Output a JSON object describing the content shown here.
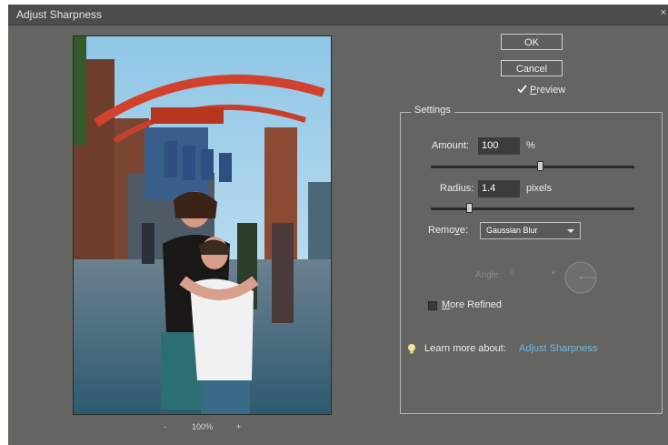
{
  "dialog": {
    "title": "Adjust Sharpness",
    "close_glyph": "×"
  },
  "buttons": {
    "ok": "OK",
    "cancel": "Cancel"
  },
  "preview_toggle": {
    "label": "Preview",
    "checked": true
  },
  "zoom": {
    "minus": "-",
    "level": "100%",
    "plus": "+"
  },
  "settings": {
    "title": "Settings",
    "amount": {
      "label": "Amount:",
      "value": "100",
      "unit": "%",
      "slider_fraction": 0.54
    },
    "radius": {
      "label": "Radius:",
      "value": "1.4",
      "unit": "pixels",
      "slider_fraction": 0.19
    },
    "remove": {
      "label": "Remove:",
      "selected": "Gaussian Blur"
    },
    "angle": {
      "label": "Angle:",
      "value": "0",
      "enabled": false
    },
    "more_refined": {
      "label": "More Refined",
      "checked": false
    }
  },
  "learn_more": {
    "prefix": "Learn more about:",
    "link": "Adjust Sharpness"
  }
}
